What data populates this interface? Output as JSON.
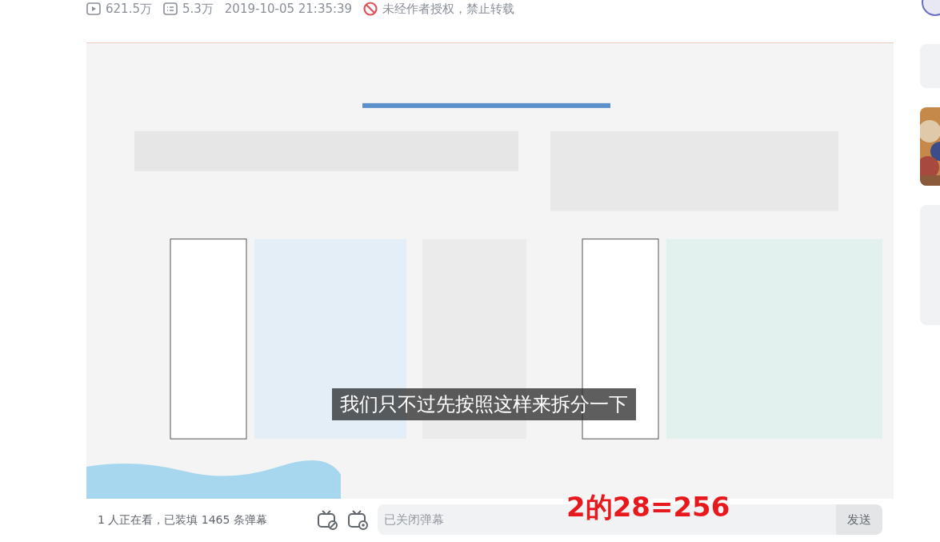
{
  "stats": [
    {
      "kind": "play",
      "text": "621.5万"
    },
    {
      "kind": "danmaku",
      "text": "5.3万"
    },
    {
      "kind": "date",
      "text": "2019-10-05 21:35:39"
    },
    {
      "kind": "forbid",
      "text": "未经作者授权，禁止转载"
    }
  ],
  "player": {
    "subtitle": "我们只不过先按照这样来拆分一下",
    "viewers": "1 人正在看，已装填 1465 条弹幕",
    "danmaku_placeholder": "已关闭弹幕",
    "send": "发送"
  },
  "annotation": "2的28=256"
}
